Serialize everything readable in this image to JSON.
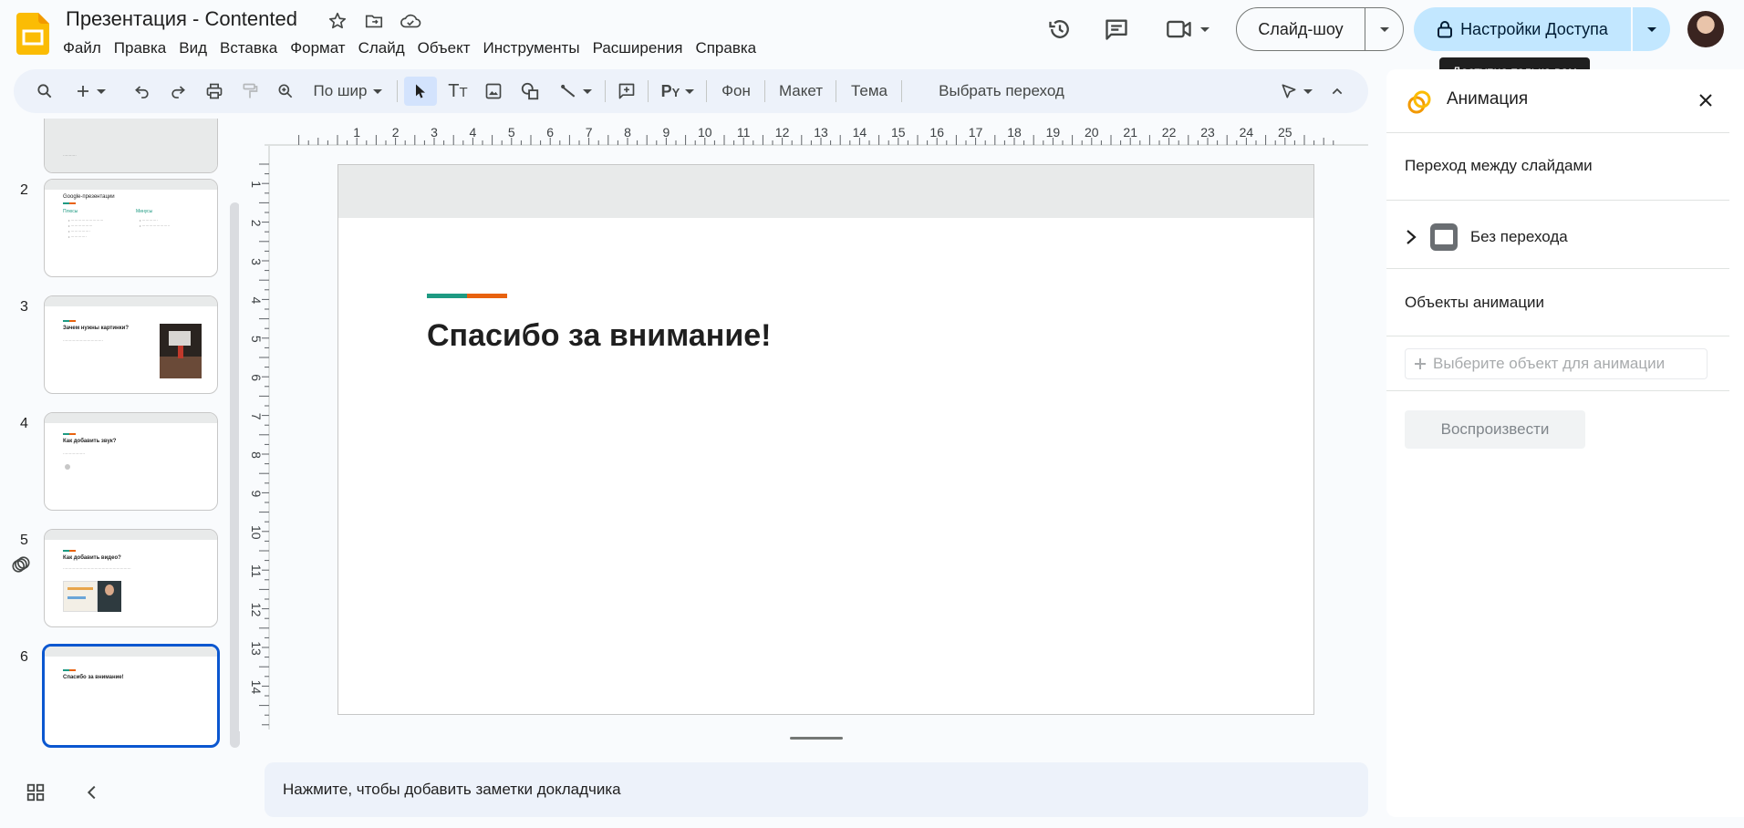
{
  "app": {
    "title": "Презентация - Contented"
  },
  "menu": [
    "Файл",
    "Правка",
    "Вид",
    "Вставка",
    "Формат",
    "Слайд",
    "Объект",
    "Инструменты",
    "Расширения",
    "Справка"
  ],
  "header": {
    "slideshow_label": "Слайд-шоу",
    "share_label": "Настройки Доступа",
    "tooltip": "Доступно только вам"
  },
  "toolbar": {
    "zoom_label": "По шир",
    "background_label": "Фон",
    "layout_label": "Макет",
    "theme_label": "Тема",
    "transition_label": "Выбрать переход"
  },
  "rulers": {
    "horizontal": [
      "1",
      "2",
      "3",
      "4",
      "5",
      "6",
      "7",
      "8",
      "9",
      "10",
      "11",
      "12",
      "13",
      "14",
      "15",
      "16",
      "17",
      "18",
      "19",
      "20",
      "21",
      "22",
      "23",
      "24",
      "25"
    ],
    "vertical": [
      "1",
      "2",
      "3",
      "4",
      "5",
      "6",
      "7",
      "8",
      "9",
      "10",
      "11",
      "12",
      "13",
      "14"
    ]
  },
  "slides": [
    {
      "number": "2",
      "title": "Google-презентации",
      "col1": "Плюсы",
      "col2": "Минусы"
    },
    {
      "number": "3",
      "title": "Зачем нужны картинки?"
    },
    {
      "number": "4",
      "title": "Как добавить звук?"
    },
    {
      "number": "5",
      "title": "Как добавить видео?"
    },
    {
      "number": "6",
      "title": "Спасибо за внимание!"
    }
  ],
  "current_slide": {
    "title": "Спасибо за внимание!"
  },
  "notes_placeholder": "Нажмите, чтобы добавить заметки докладчика",
  "panel": {
    "title": "Анимация",
    "transition_heading": "Переход между слайдами",
    "transition_value": "Без перехода",
    "objects_heading": "Объекты анимации",
    "add_object": "Выберите объект для анимации",
    "play": "Воспроизвести"
  },
  "colors": {
    "accent_teal": "#1e9a82",
    "accent_orange": "#e8620f",
    "share_bg": "#c2e7ff",
    "selected_blue": "#0b57d0"
  }
}
